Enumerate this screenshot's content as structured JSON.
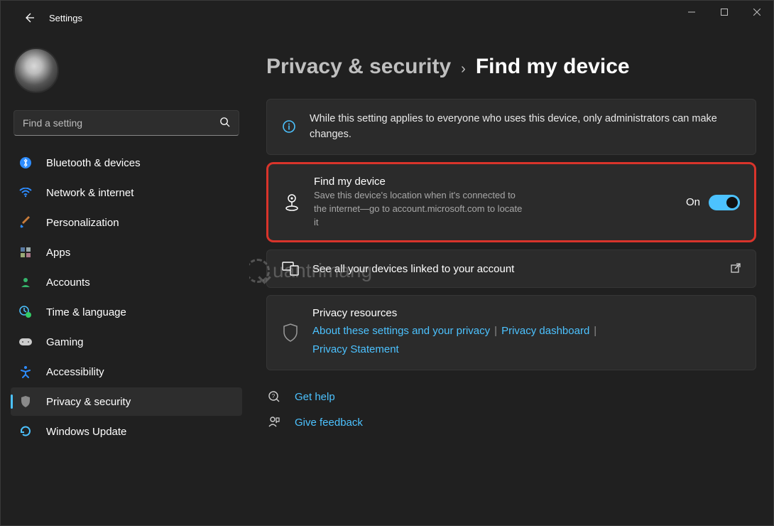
{
  "app_title": "Settings",
  "search": {
    "placeholder": "Find a setting"
  },
  "sidebar": {
    "items": [
      {
        "label": "Bluetooth & devices"
      },
      {
        "label": "Network & internet"
      },
      {
        "label": "Personalization"
      },
      {
        "label": "Apps"
      },
      {
        "label": "Accounts"
      },
      {
        "label": "Time & language"
      },
      {
        "label": "Gaming"
      },
      {
        "label": "Accessibility"
      },
      {
        "label": "Privacy & security"
      },
      {
        "label": "Windows Update"
      }
    ]
  },
  "breadcrumb": {
    "parent": "Privacy & security",
    "current": "Find my device"
  },
  "info_banner": "While this setting applies to everyone who uses this device, only administrators can make changes.",
  "find_my_device": {
    "title": "Find my device",
    "description": "Save this device's location when it's connected to the internet—go to account.microsoft.com to locate it",
    "state_label": "On"
  },
  "linked_devices": {
    "label": "See all your devices linked to your account"
  },
  "privacy_resources": {
    "title": "Privacy resources",
    "links": {
      "about": "About these settings and your privacy",
      "dashboard": "Privacy dashboard",
      "statement": "Privacy Statement"
    }
  },
  "footer": {
    "help": "Get help",
    "feedback": "Give feedback"
  },
  "watermark": "uantrimang"
}
